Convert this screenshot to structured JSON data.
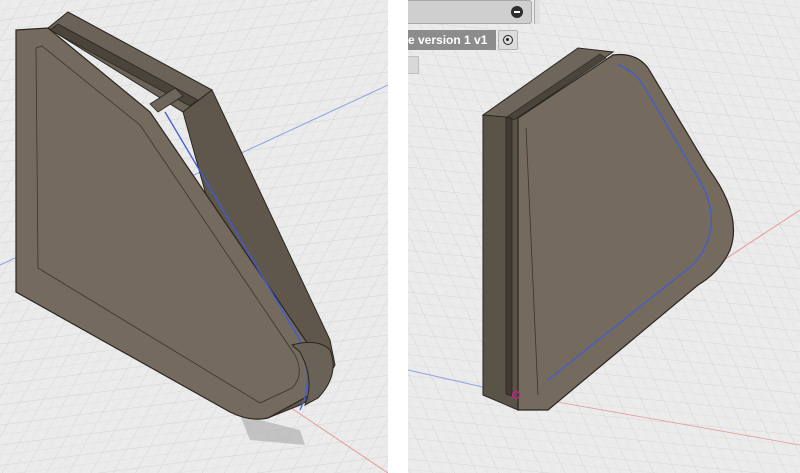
{
  "viewports": {
    "right": {
      "toolbar": {
        "version_label": "e version 1 v1"
      }
    }
  },
  "colors": {
    "background": "#e9e9e9",
    "grid_minor": "#d6d6d6",
    "grid_major": "#c4c4c4",
    "body_face": "#72695c",
    "body_side": "#5e5649",
    "body_edge": "#2a2620",
    "axis_x": "#e05555",
    "axis_y": "#5a6fd6",
    "sketch_line": "#3c5cd8",
    "origin_point": "#c0208a"
  },
  "icons": [
    "collapse-icon",
    "visibility-toggle-icon"
  ]
}
